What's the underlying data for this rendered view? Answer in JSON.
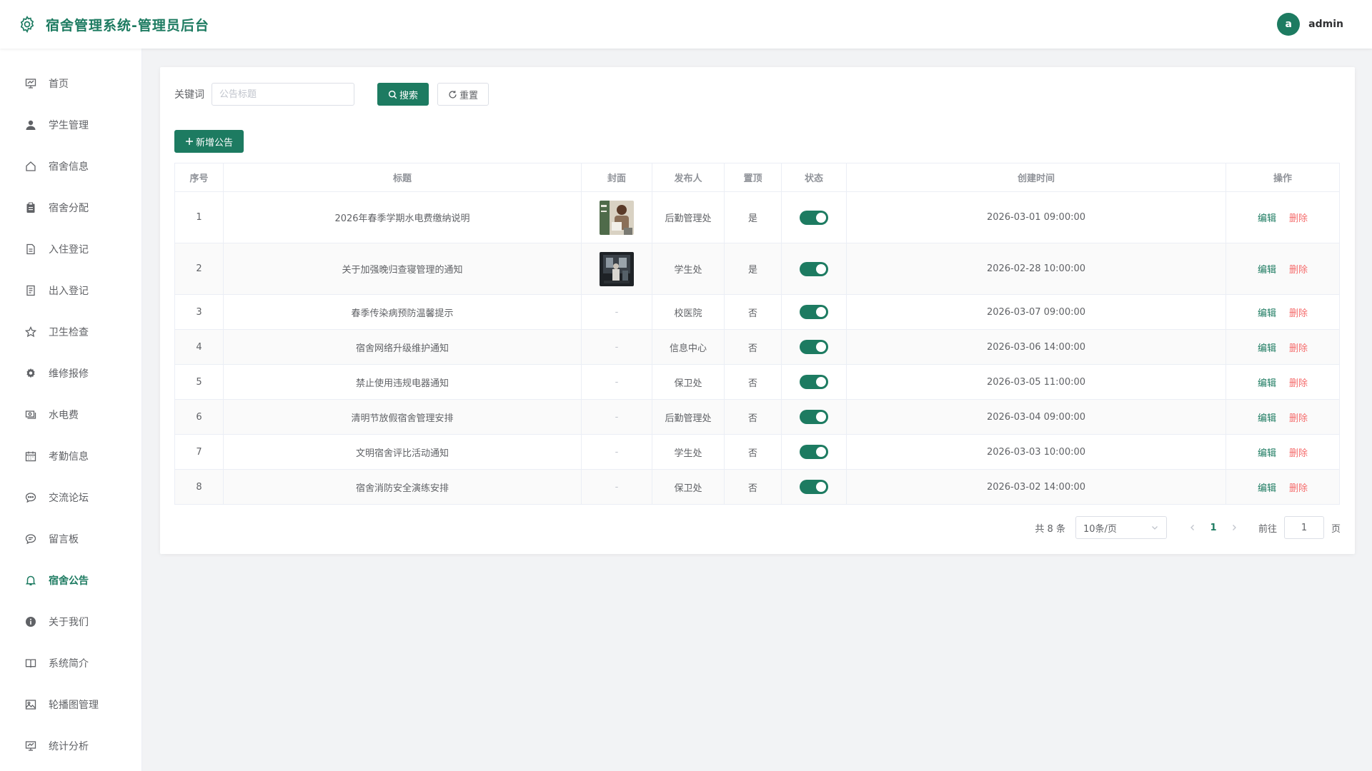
{
  "header": {
    "title": "宿舍管理系统-管理员后台",
    "avatar_letter": "a",
    "username": "admin"
  },
  "sidebar": {
    "items": [
      {
        "label": "首页",
        "icon": "presentation-icon"
      },
      {
        "label": "学生管理",
        "icon": "user-icon"
      },
      {
        "label": "宿舍信息",
        "icon": "house-icon"
      },
      {
        "label": "宿舍分配",
        "icon": "clipboard-icon"
      },
      {
        "label": "入住登记",
        "icon": "document-icon"
      },
      {
        "label": "出入登记",
        "icon": "tickets-icon"
      },
      {
        "label": "卫生检查",
        "icon": "star-icon"
      },
      {
        "label": "维修报修",
        "icon": "gear-icon"
      },
      {
        "label": "水电费",
        "icon": "money-icon"
      },
      {
        "label": "考勤信息",
        "icon": "calendar-icon"
      },
      {
        "label": "交流论坛",
        "icon": "chat-dots-icon"
      },
      {
        "label": "留言板",
        "icon": "chat-line-icon"
      },
      {
        "label": "宿舍公告",
        "icon": "bell-icon"
      },
      {
        "label": "关于我们",
        "icon": "info-icon"
      },
      {
        "label": "系统简介",
        "icon": "notebook-icon"
      },
      {
        "label": "轮播图管理",
        "icon": "picture-icon"
      },
      {
        "label": "统计分析",
        "icon": "presentation-icon"
      }
    ],
    "active_index": 12
  },
  "search": {
    "label": "关键词",
    "placeholder": "公告标题",
    "search_button": "搜索",
    "reset_button": "重置"
  },
  "toolbar": {
    "add_button": "新增公告"
  },
  "table": {
    "headers": [
      "序号",
      "标题",
      "封面",
      "发布人",
      "置顶",
      "状态",
      "创建时间",
      "操作"
    ],
    "rows": [
      {
        "index": "1",
        "title": "2026年春季学期水电费缴纳说明",
        "cover": "image",
        "publisher": "后勤管理处",
        "pinned": "是",
        "status": true,
        "created": "2026-03-01 09:00:00"
      },
      {
        "index": "2",
        "title": "关于加强晚归查寝管理的通知",
        "cover": "image",
        "publisher": "学生处",
        "pinned": "是",
        "status": true,
        "created": "2026-02-28 10:00:00"
      },
      {
        "index": "3",
        "title": "春季传染病预防温馨提示",
        "cover": "-",
        "publisher": "校医院",
        "pinned": "否",
        "status": true,
        "created": "2026-03-07 09:00:00"
      },
      {
        "index": "4",
        "title": "宿舍网络升级维护通知",
        "cover": "-",
        "publisher": "信息中心",
        "pinned": "否",
        "status": true,
        "created": "2026-03-06 14:00:00"
      },
      {
        "index": "5",
        "title": "禁止使用违规电器通知",
        "cover": "-",
        "publisher": "保卫处",
        "pinned": "否",
        "status": true,
        "created": "2026-03-05 11:00:00"
      },
      {
        "index": "6",
        "title": "清明节放假宿舍管理安排",
        "cover": "-",
        "publisher": "后勤管理处",
        "pinned": "否",
        "status": true,
        "created": "2026-03-04 09:00:00"
      },
      {
        "index": "7",
        "title": "文明宿舍评比活动通知",
        "cover": "-",
        "publisher": "学生处",
        "pinned": "否",
        "status": true,
        "created": "2026-03-03 10:00:00"
      },
      {
        "index": "8",
        "title": "宿舍消防安全演练安排",
        "cover": "-",
        "publisher": "保卫处",
        "pinned": "否",
        "status": true,
        "created": "2026-03-02 14:00:00"
      }
    ],
    "edit_label": "编辑",
    "delete_label": "删除"
  },
  "pagination": {
    "total": "共 8 条",
    "page_size": "10条/页",
    "current_page": "1",
    "goto_label": "前往",
    "goto_value": "1",
    "page_suffix": "页"
  },
  "colors": {
    "primary": "#1d7b61",
    "danger": "#f56c6c"
  }
}
